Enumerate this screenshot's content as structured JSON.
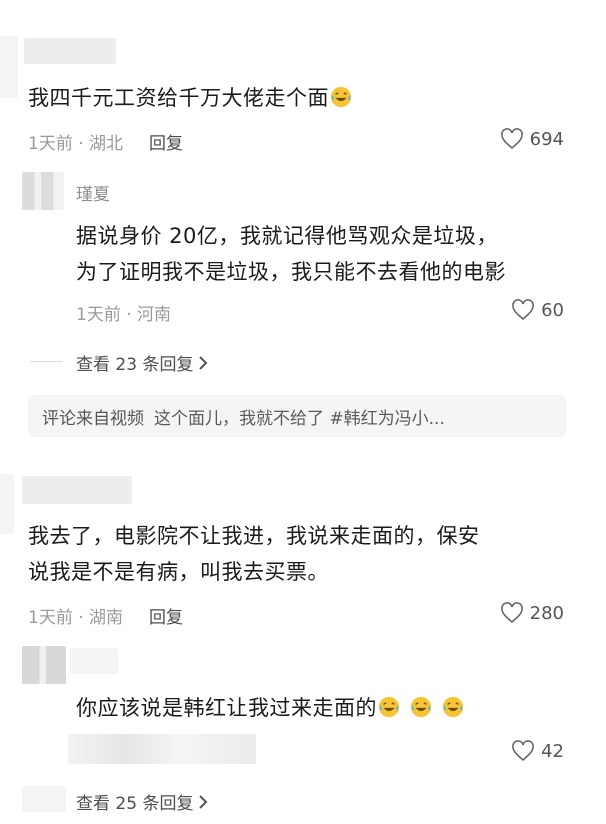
{
  "comments": [
    {
      "text": "我四千元工资给千万大佬走个面",
      "emoji_count": 1,
      "meta": "1天前 · 湖北",
      "reply_label": "回复",
      "likes": "694",
      "replies": [
        {
          "username": "瑾夏",
          "text_line1": "据说身价 20亿，我就记得他骂观众是垃圾，",
          "text_line2": "为了证明我不是垃圾，我只能不去看他的电影",
          "meta": "1天前 · 河南",
          "likes": "60"
        }
      ],
      "more_replies": "查看 23 条回复",
      "source_label": "评论来自视频",
      "source_text": "这个面儿，我就不给了 #韩红为冯小..."
    },
    {
      "text_line1": "我去了，电影院不让我进，我说来走面的，保安",
      "text_line2": "说我是不是有病，叫我去买票。",
      "meta": "1天前 · 湖南",
      "reply_label": "回复",
      "likes": "280",
      "replies": [
        {
          "text": "你应该说是韩红让我过来走面的",
          "emoji_count": 3,
          "likes": "42"
        }
      ],
      "more_replies": "查看 25 条回复"
    }
  ],
  "icons": {
    "like": "heart-outline-icon",
    "emoji": "laughing-crying-emoji-icon",
    "more": "chevron-right-icon"
  },
  "colors": {
    "meta": "#9a9a9a",
    "emoji": "#f7c531"
  }
}
